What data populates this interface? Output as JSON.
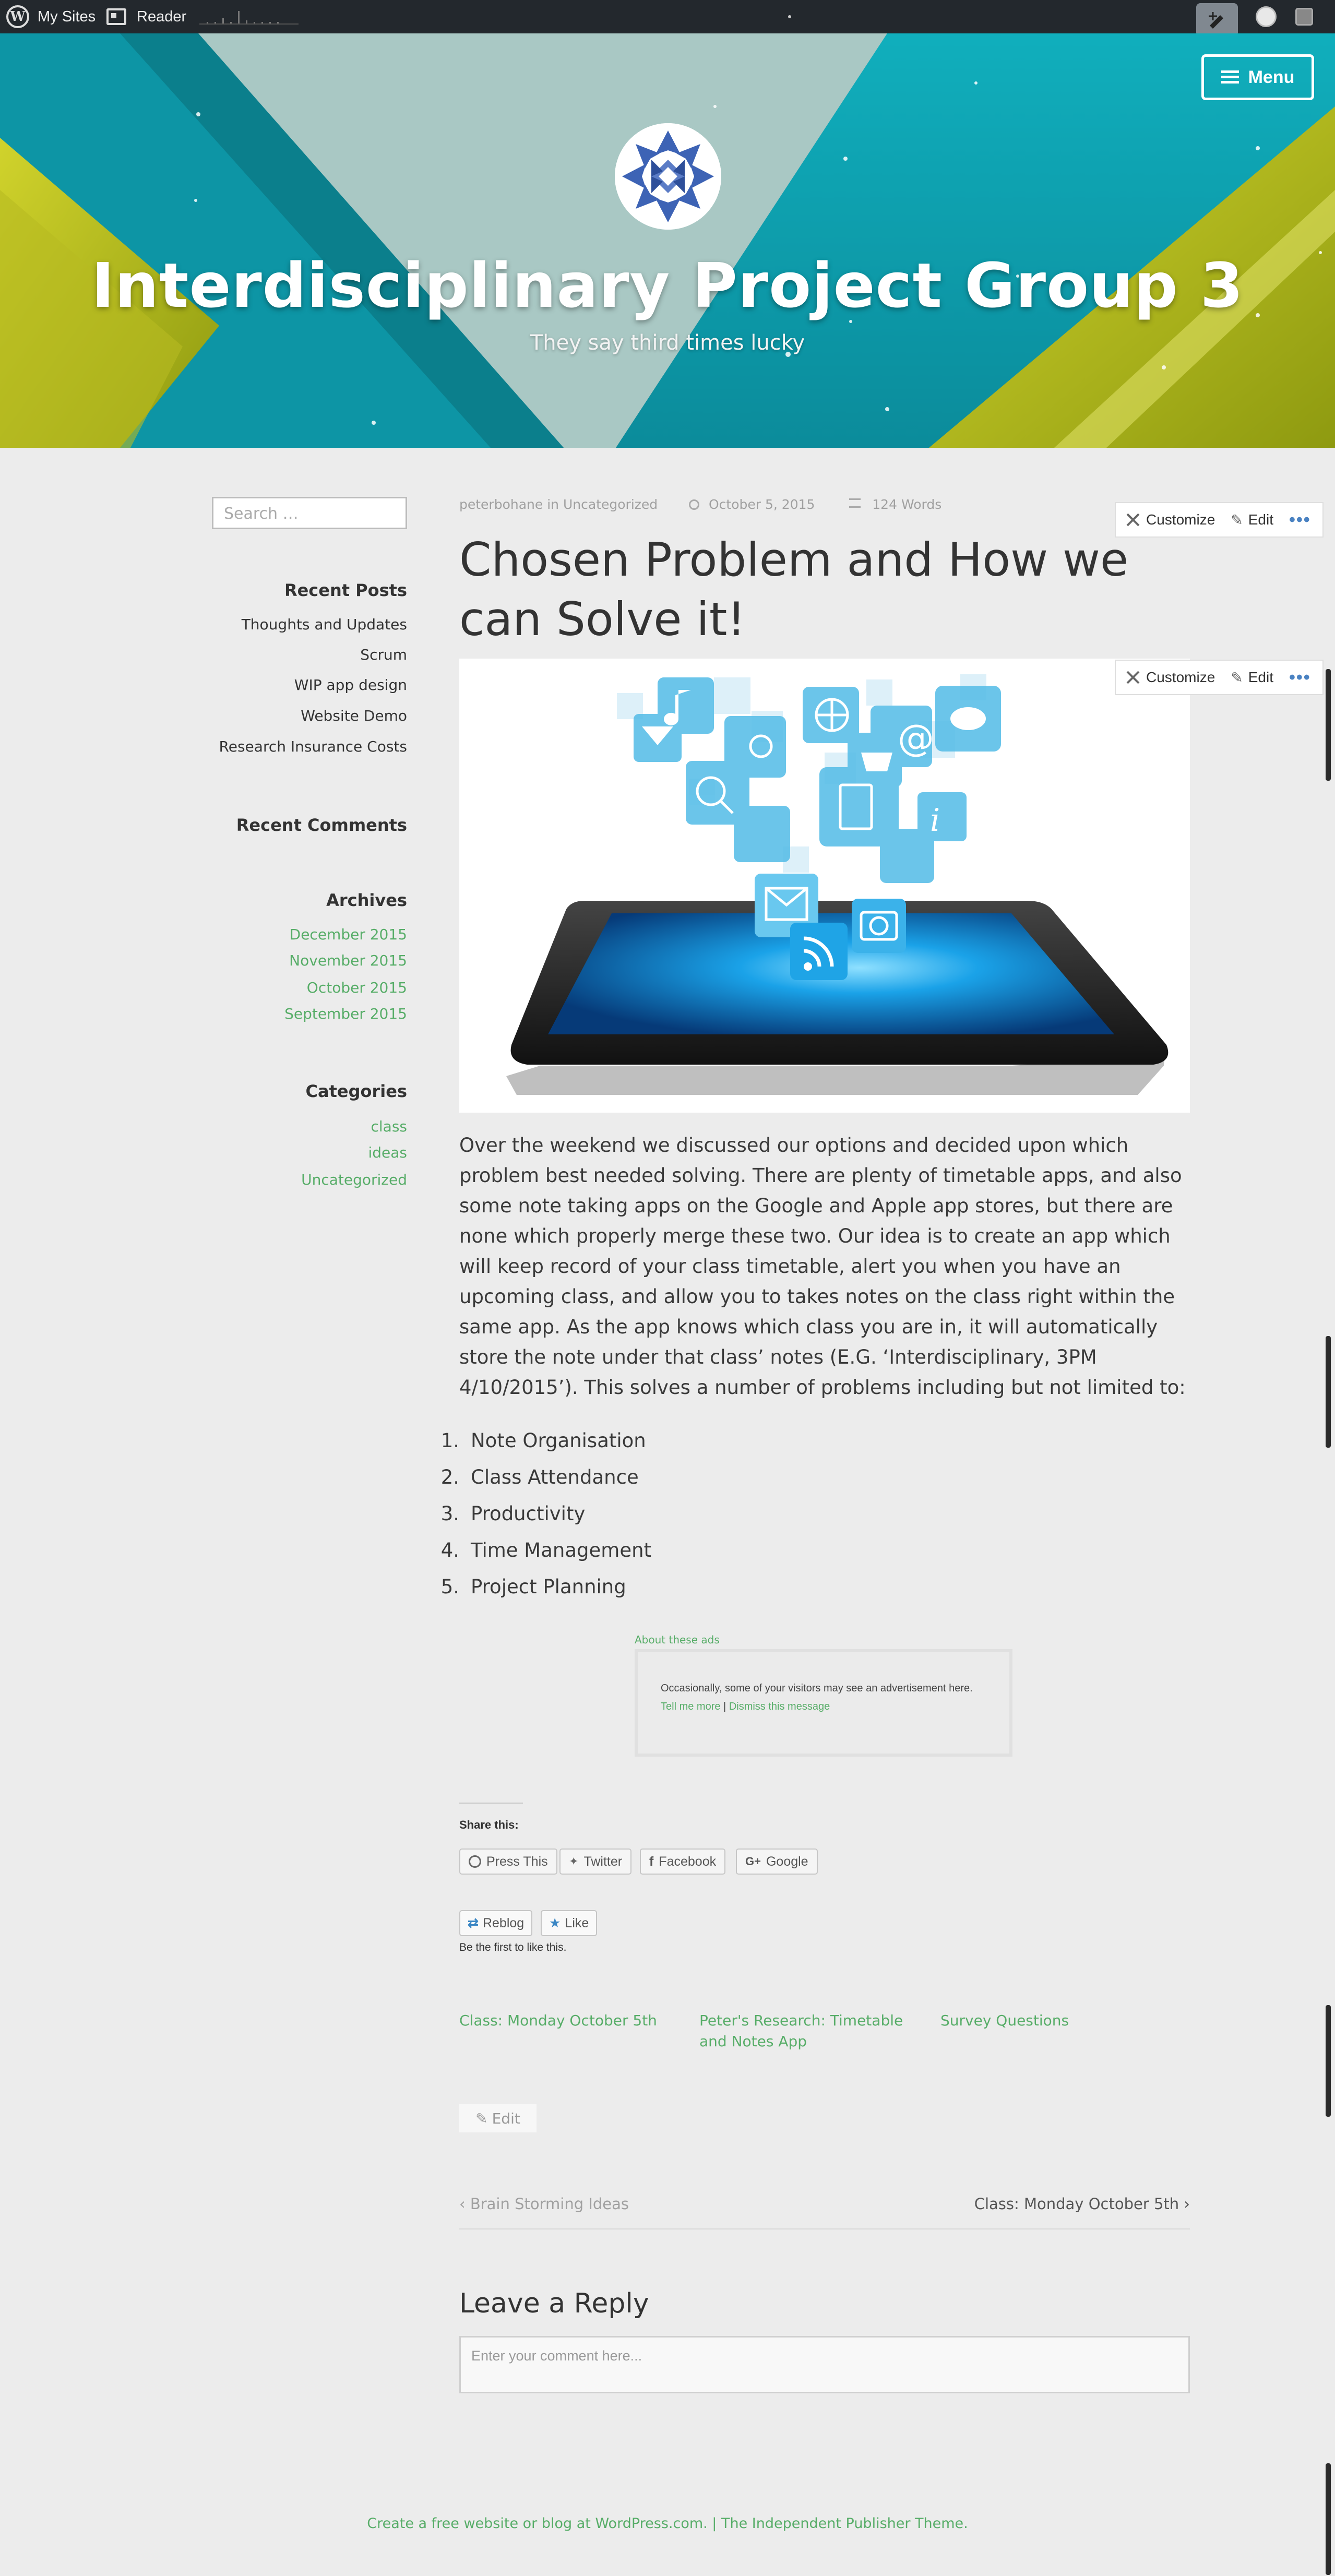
{
  "adminbar": {
    "my_sites": "My Sites",
    "reader": "Reader"
  },
  "header": {
    "menu_label": "Menu",
    "site_title": "Interdisciplinary Project Group 3",
    "site_description": "They say third times lucky",
    "colors": {
      "teal": "#0e9fae",
      "light": "#a7c6c2",
      "yellow": "#c4c626"
    }
  },
  "sidebar": {
    "search_placeholder": "Search …",
    "recent_posts_title": "Recent Posts",
    "recent_posts": [
      "Thoughts and Updates",
      "Scrum",
      "WIP app design",
      "Website Demo",
      "Research Insurance Costs"
    ],
    "recent_comments_title": "Recent Comments",
    "archives_title": "Archives",
    "archives": [
      "December 2015",
      "November 2015",
      "October 2015",
      "September 2015"
    ],
    "categories_title": "Categories",
    "categories": [
      "class",
      "ideas",
      "Uncategorized"
    ]
  },
  "post": {
    "author": "peterbohane",
    "in_label": "in",
    "category": "Uncategorized",
    "date": "October 5, 2015",
    "word_count": "124 Words",
    "title": "Chosen Problem and How we can Solve it!",
    "body": "Over the weekend we discussed our options and decided upon which problem best needed solving. There are plenty of timetable apps, and also some note taking apps on the Google and Apple app stores, but there are none which properly merge these two. Our idea is to create an app which will keep record of your class timetable, alert you when you have an upcoming class, and allow you to takes notes on the class right within the same app. As the app knows which class you are in, it will automatically store the note under that class’ notes (E.G. ‘Interdisciplinary, 3PM 4/10/2015’). This solves a number of problems including but not limited to:",
    "list": [
      "Note Organisation",
      "Class Attendance",
      "Productivity",
      "Time Management",
      "Project Planning"
    ],
    "list_numbers": [
      "1.",
      "2.",
      "3.",
      "4.",
      "5."
    ]
  },
  "ad": {
    "label": "About these ads",
    "message": "Occasionally, some of your visitors may see an advertisement here.",
    "tell_more": "Tell me more",
    "separator": "|",
    "dismiss": "Dismiss this message"
  },
  "share": {
    "title": "Share this:",
    "buttons": [
      "Press This",
      "Twitter",
      "Facebook",
      "Google"
    ]
  },
  "like": {
    "reblog": "Reblog",
    "like": "Like",
    "first": "Be the first to like this."
  },
  "related": [
    "Class: Monday October 5th",
    "Peter's Research: Timetable and Notes App",
    "Survey Questions"
  ],
  "edit_label": "Edit",
  "nav": {
    "prev": "Brain Storming Ideas",
    "next": "Class: Monday October 5th"
  },
  "reply": {
    "title": "Leave a Reply",
    "placeholder": "Enter your comment here..."
  },
  "footer": {
    "text": "Create a free website or blog at WordPress.com. | The Independent Publisher Theme."
  },
  "toolbar": {
    "customize": "Customize",
    "edit": "Edit",
    "more": "•••"
  }
}
